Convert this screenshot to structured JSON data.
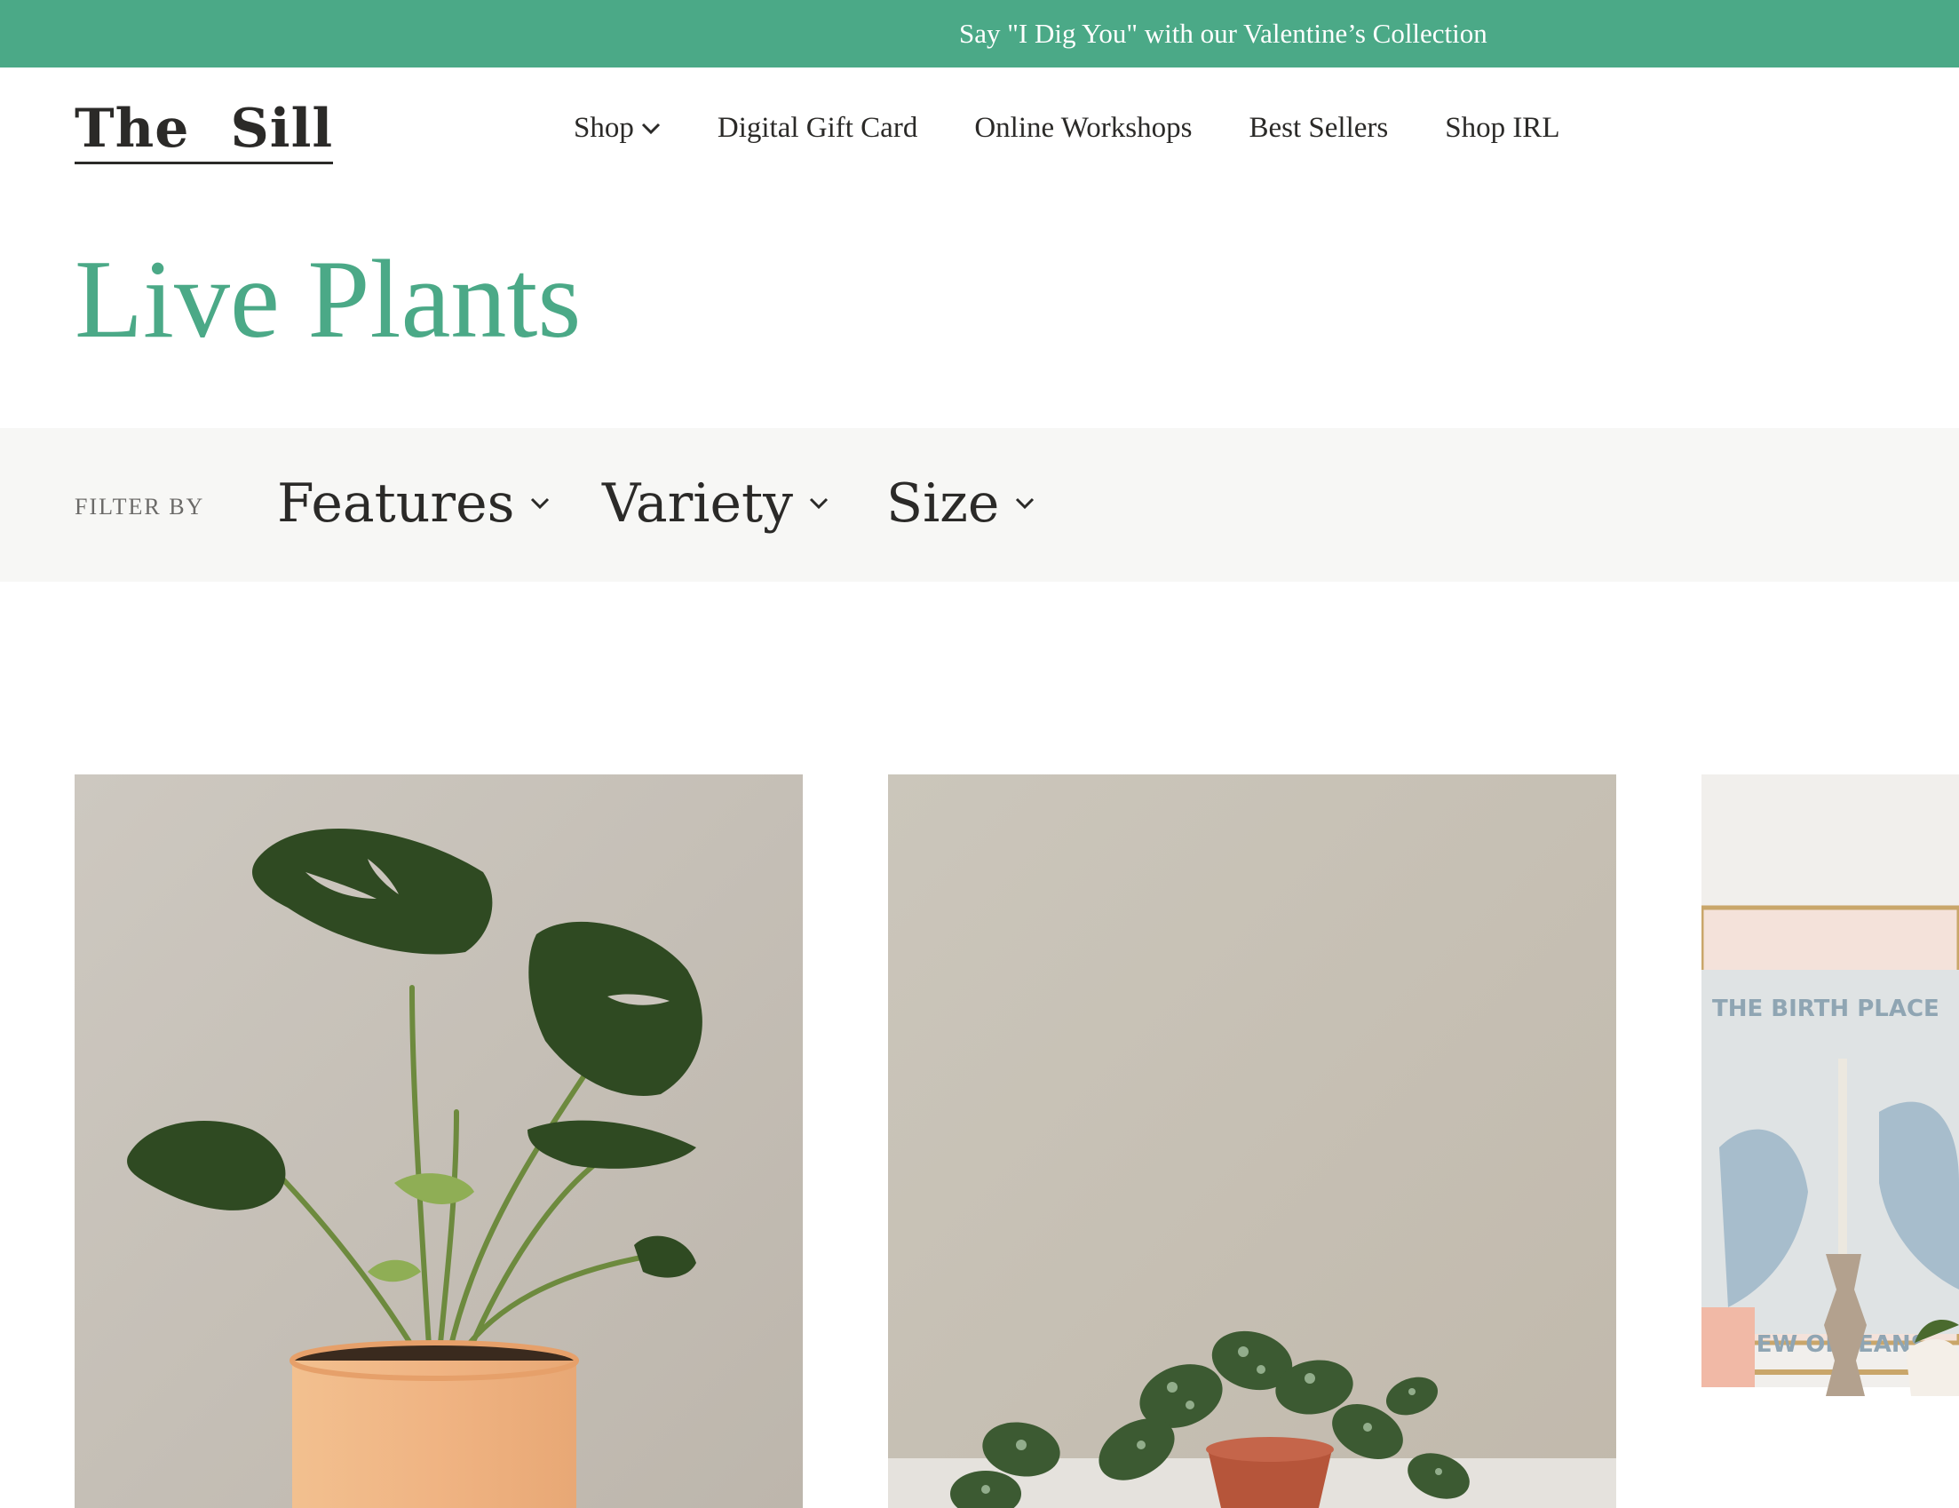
{
  "promo": {
    "text": "Say \"I Dig You\" with our Valentine’s Collection"
  },
  "logo": {
    "word1": "The",
    "word2": "Sill"
  },
  "nav": [
    {
      "label": "Shop",
      "has_dropdown": true
    },
    {
      "label": "Digital Gift Card"
    },
    {
      "label": "Online Workshops"
    },
    {
      "label": "Best Sellers"
    },
    {
      "label": "Shop IRL"
    }
  ],
  "page": {
    "title": "Live Plants"
  },
  "filters": {
    "label": "FILTER BY",
    "items": [
      {
        "label": "Features"
      },
      {
        "label": "Variety"
      },
      {
        "label": "Size"
      }
    ]
  },
  "products": [
    {
      "image": "monstera-in-peach-pot"
    },
    {
      "image": "pothos-in-terracotta-pot"
    },
    {
      "image": "lifestyle-shelf-poster",
      "poster_text_top": "THE BIRTH PLACE",
      "poster_text_bottom": "NEW ORLEANS"
    }
  ],
  "colors": {
    "accent": "#4ba987",
    "text": "#2b2a28",
    "filter_bg": "#f7f7f5"
  }
}
